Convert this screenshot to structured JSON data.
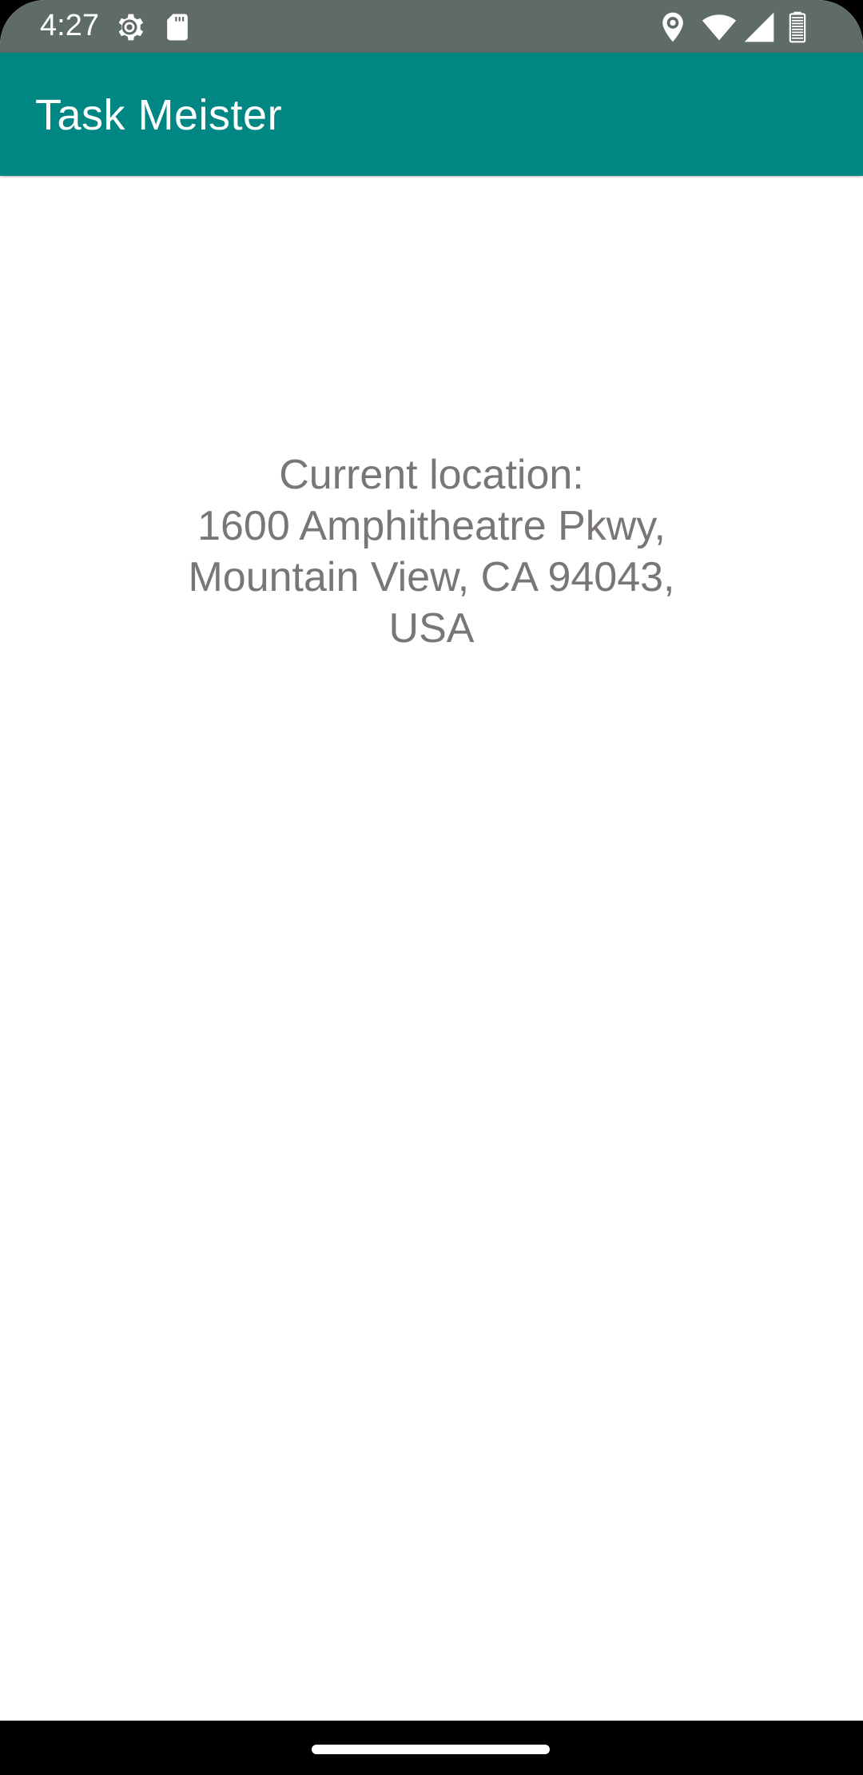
{
  "status_bar": {
    "time": "4:27",
    "icons": [
      "settings-gear-icon",
      "sd-card-icon",
      "location-pin-icon",
      "wifi-icon",
      "cell-signal-icon",
      "battery-icon"
    ],
    "background_color": "#5f6b68"
  },
  "app_bar": {
    "title": "Task Meister",
    "background_color": "#008784"
  },
  "location": {
    "label": "Current location:",
    "address_lines": [
      "1600 Amphitheatre Pkwy,",
      "Mountain View, CA 94043,",
      "USA"
    ],
    "text_color": "#7a7676"
  },
  "nav_bar": {
    "handle": "home-gesture-handle"
  }
}
